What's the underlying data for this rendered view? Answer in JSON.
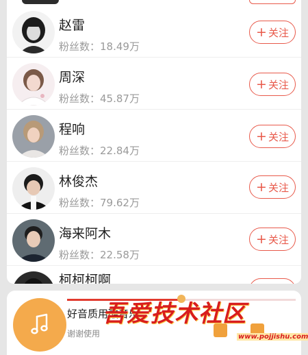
{
  "list": {
    "follow_label": "关注",
    "follow_icon": "plus-icon",
    "fans_prefix": "粉丝数：",
    "artists": [
      {
        "name": "赵雷",
        "fans": "粉丝数：18.49万"
      },
      {
        "name": "周深",
        "fans": "粉丝数：45.87万"
      },
      {
        "name": "程响",
        "fans": "粉丝数：22.84万"
      },
      {
        "name": "林俊杰",
        "fans": "粉丝数：79.62万"
      },
      {
        "name": "海来阿木",
        "fans": "粉丝数：22.58万"
      },
      {
        "name": "柯柯柯啊",
        "fans": ""
      }
    ]
  },
  "player": {
    "title": "好音质用酷音乐",
    "subtitle": "谢谢使用",
    "disc_icon": "music-note-icon",
    "progress": 0.5,
    "accent": "#e23a2e",
    "disc_color": "#f4aa4c"
  },
  "watermark": {
    "text": "吾爱技术社区",
    "url": "www.pojjishu.com"
  },
  "colors": {
    "follow": "#e8594a",
    "name": "#222222",
    "fans": "#9a9a9a",
    "background": "#e6e6e6"
  }
}
